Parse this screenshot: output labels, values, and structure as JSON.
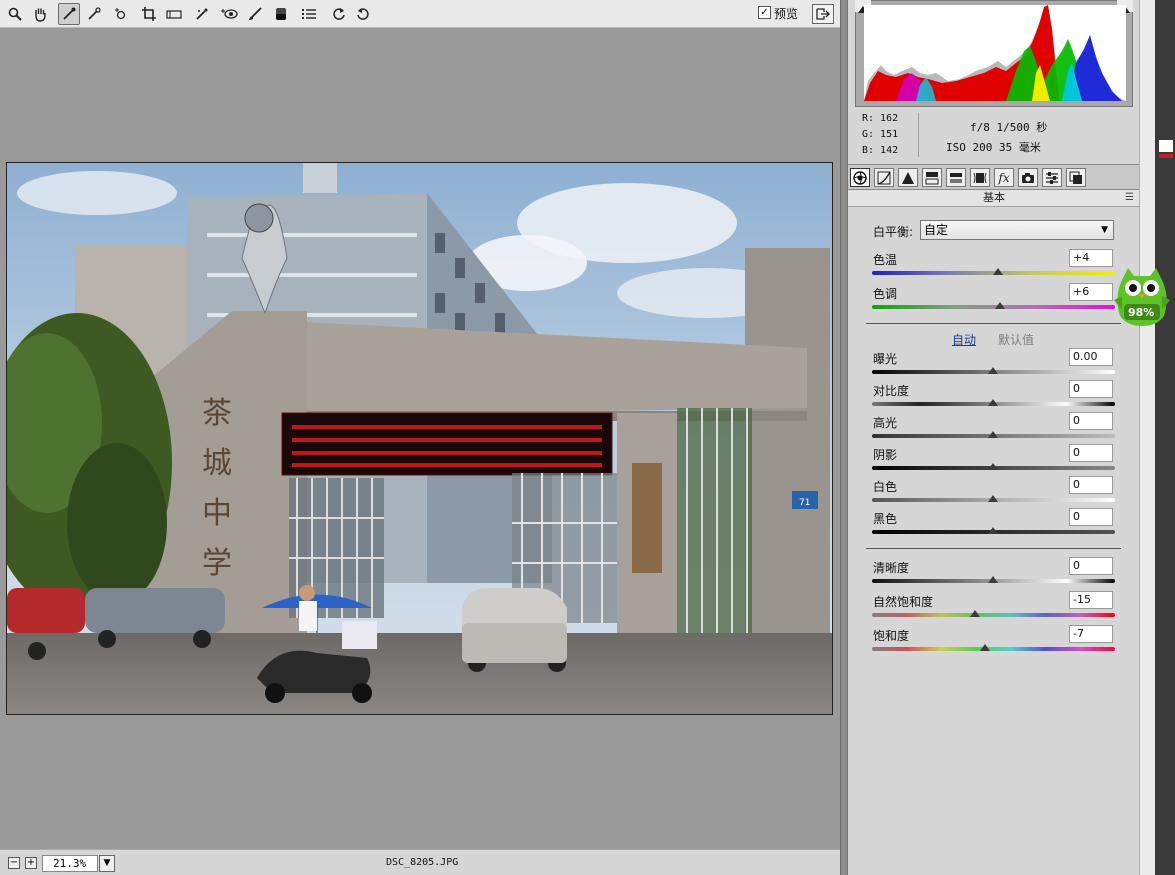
{
  "toolbar": {
    "tools": [
      {
        "name": "zoom-tool",
        "glyph": "🔍"
      },
      {
        "name": "hand-tool",
        "glyph": "✋"
      },
      {
        "name": "white-balance-tool",
        "glyph": "✎"
      },
      {
        "name": "color-sampler-tool",
        "glyph": "✒"
      },
      {
        "name": "targeted-adjustment-tool",
        "glyph": "⊕"
      },
      {
        "name": "crop-tool",
        "glyph": "⌗"
      },
      {
        "name": "straighten-tool",
        "glyph": "▭"
      },
      {
        "name": "spot-removal-tool",
        "glyph": "✐"
      },
      {
        "name": "red-eye-tool",
        "glyph": "◉"
      },
      {
        "name": "adjustment-brush-tool",
        "glyph": "🖌"
      },
      {
        "name": "graduated-filter-tool",
        "glyph": "▮"
      },
      {
        "name": "preferences-tool",
        "glyph": "☰"
      },
      {
        "name": "rotate-left-tool",
        "glyph": "↺"
      },
      {
        "name": "rotate-right-tool",
        "glyph": "↻"
      }
    ],
    "preview_label": "预览",
    "preview_checked": true
  },
  "status": {
    "zoom": "21.3%",
    "filename": "DSC_8205.JPG",
    "zoom_out": "−",
    "zoom_in": "+"
  },
  "info": {
    "r": "R:  162",
    "g": "G:  151",
    "b": "B:  142",
    "camera1": "f/8   1/500 秒",
    "camera2": "ISO 200   35 毫米"
  },
  "panel": {
    "section_title": "基本",
    "tabs": [
      "basic-tab",
      "tone-curve-tab",
      "detail-tab",
      "hsl-tab",
      "split-toning-tab",
      "lens-corrections-tab",
      "effects-tab",
      "camera-calibration-tab",
      "presets-tab",
      "snapshots-tab"
    ],
    "white_balance": {
      "label": "白平衡:",
      "value": "自定"
    },
    "temperature": {
      "label": "色温",
      "value": "+4"
    },
    "tint": {
      "label": "色调",
      "value": "+6"
    },
    "auto_label": "自动",
    "default_label": "默认值",
    "exposure": {
      "label": "曝光",
      "value": "0.00"
    },
    "contrast": {
      "label": "对比度",
      "value": "0"
    },
    "highlights": {
      "label": "高光",
      "value": "0"
    },
    "shadows": {
      "label": "阴影",
      "value": "0"
    },
    "whites": {
      "label": "白色",
      "value": "0"
    },
    "blacks": {
      "label": "黑色",
      "value": "0"
    },
    "clarity": {
      "label": "清晰度",
      "value": "0"
    },
    "vibrance": {
      "label": "自然饱和度",
      "value": "-15"
    },
    "saturation": {
      "label": "饱和度",
      "value": "-7"
    }
  },
  "photo": {
    "gate_text": "茶城中学",
    "plate_number": "71"
  },
  "widget": {
    "percent": "98%"
  }
}
